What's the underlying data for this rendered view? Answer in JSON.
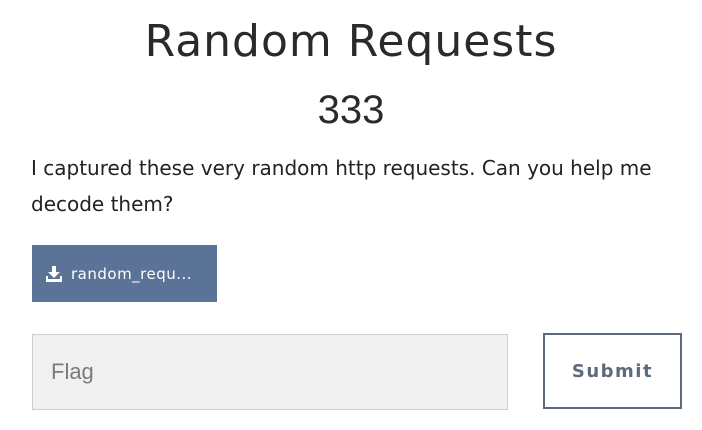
{
  "challenge": {
    "title": "Random Requests",
    "points": "333",
    "description": "I captured these very random http requests. Can you help me decode them?"
  },
  "attachment": {
    "filename": "random_requ...",
    "icon": "download-icon",
    "color": "#5a7396"
  },
  "flag_form": {
    "placeholder": "Flag",
    "value": "",
    "submit_label": "Submit"
  }
}
